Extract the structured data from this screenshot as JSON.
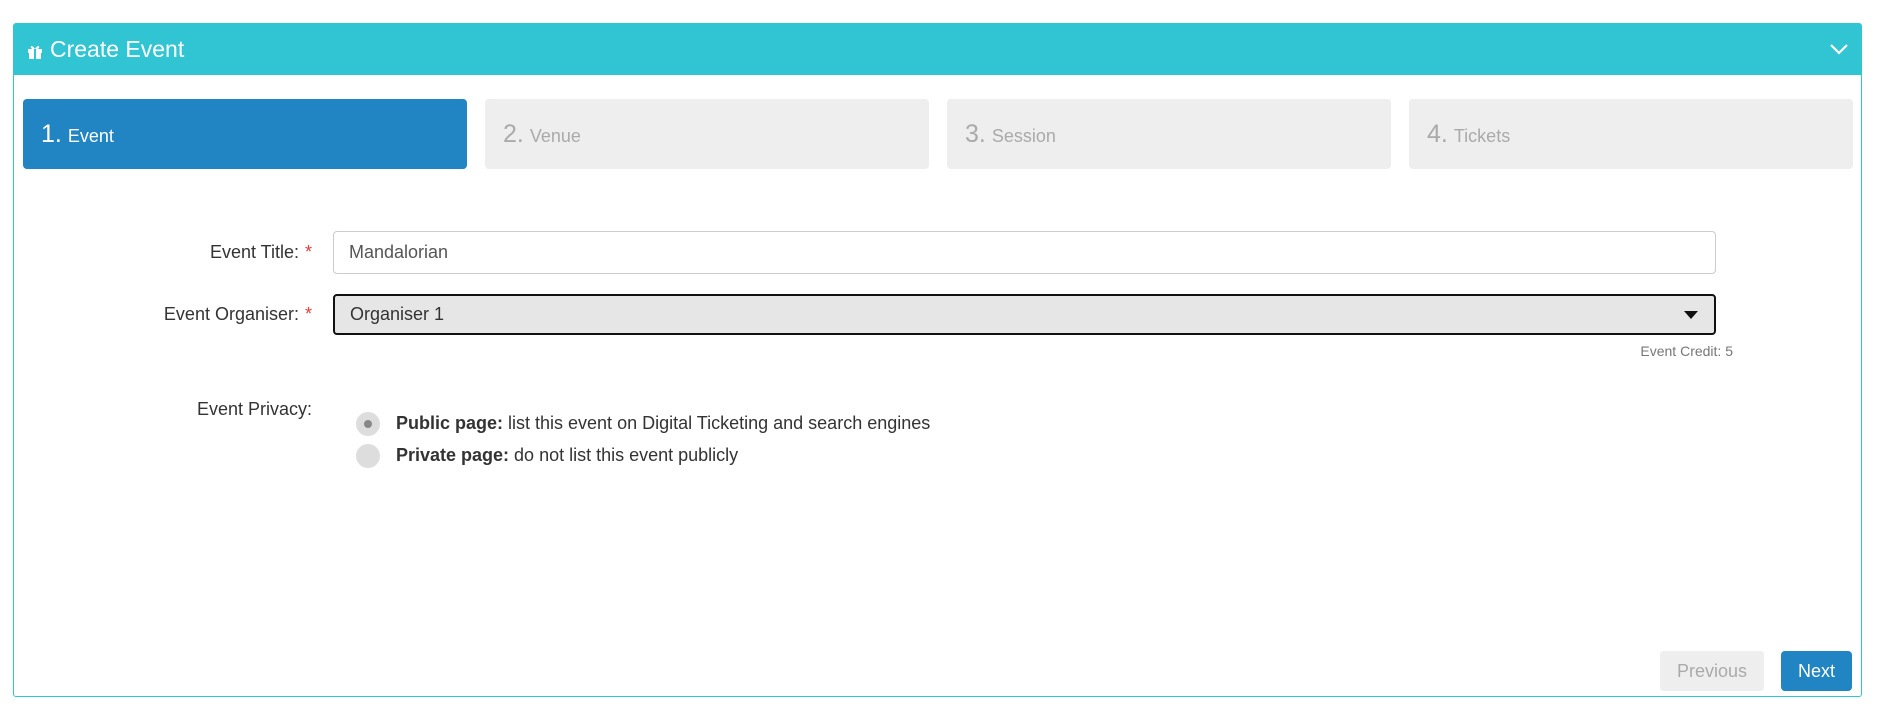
{
  "panel": {
    "title": "Create Event",
    "icon": "gift-icon",
    "collapse_icon": "chevron-down-icon",
    "header_color": "#31c5d3"
  },
  "steps": [
    {
      "num": "1.",
      "label": "Event",
      "active": true
    },
    {
      "num": "2.",
      "label": "Venue",
      "active": false
    },
    {
      "num": "3.",
      "label": "Session",
      "active": false
    },
    {
      "num": "4.",
      "label": "Tickets",
      "active": false
    }
  ],
  "form": {
    "title_label": "Event Title:",
    "title_value": "Mandalorian",
    "organiser_label": "Event Organiser:",
    "organiser_value": "Organiser 1",
    "required_mark": "*",
    "credit_text": "Event Credit: 5",
    "privacy_label": "Event Privacy:",
    "privacy_options": [
      {
        "bold": "Public page:",
        "text": " list this event on Digital Ticketing and search engines",
        "checked": true
      },
      {
        "bold": "Private page:",
        "text": " do not list this event publicly",
        "checked": false
      }
    ]
  },
  "buttons": {
    "previous": "Previous",
    "next": "Next"
  },
  "colors": {
    "accent": "#2184c3",
    "inactive_step": "#eeeeee",
    "required": "#e23c3c"
  }
}
